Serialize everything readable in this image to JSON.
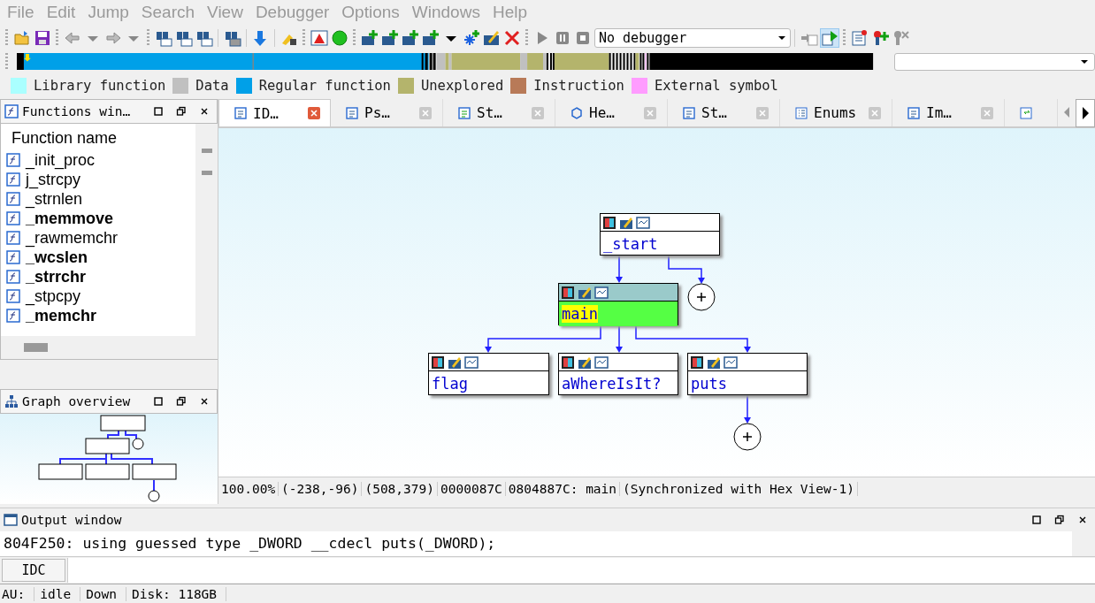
{
  "menu": [
    "File",
    "Edit",
    "Jump",
    "Search",
    "View",
    "Debugger",
    "Options",
    "Windows",
    "Help"
  ],
  "toolbar": {
    "debugger": "No debugger"
  },
  "legend": [
    {
      "label": "Library function",
      "color": "#aaffff"
    },
    {
      "label": "Data",
      "color": "#c0c0c0"
    },
    {
      "label": "Regular function",
      "color": "#00a0e8"
    },
    {
      "label": "Unexplored",
      "color": "#b4b46c"
    },
    {
      "label": "Instruction",
      "color": "#b87a58"
    },
    {
      "label": "External symbol",
      "color": "#ff9cff"
    }
  ],
  "functions_window": {
    "title": "Functions win…",
    "column": "Function name",
    "items": [
      {
        "name": "_init_proc",
        "bold": false
      },
      {
        "name": "j_strcpy",
        "bold": false
      },
      {
        "name": "_strnlen",
        "bold": false
      },
      {
        "name": "_memmove",
        "bold": true
      },
      {
        "name": "_rawmemchr",
        "bold": false
      },
      {
        "name": "_wcslen",
        "bold": true
      },
      {
        "name": "_strrchr",
        "bold": true
      },
      {
        "name": "_stpcpy",
        "bold": false
      },
      {
        "name": "_memchr",
        "bold": true
      }
    ]
  },
  "graph_overview": {
    "title": "Graph overview"
  },
  "tabs": [
    {
      "label": "ID…",
      "selected": true
    },
    {
      "label": "Ps…",
      "selected": false
    },
    {
      "label": "St…",
      "selected": false
    },
    {
      "label": "He…",
      "selected": false
    },
    {
      "label": "St…",
      "selected": false
    },
    {
      "label": "Enums",
      "selected": false
    },
    {
      "label": "Im…",
      "selected": false
    }
  ],
  "graph": {
    "nodes": [
      {
        "label": "_start",
        "selected": false
      },
      {
        "label": "main",
        "selected": true
      },
      {
        "label": "flag",
        "selected": false
      },
      {
        "label": "aWhereIsIt?",
        "selected": false
      },
      {
        "label": "puts",
        "selected": false
      }
    ]
  },
  "graph_status": [
    "100.00%",
    "(-238,-96)",
    "(508,379)",
    "0000087C",
    "0804887C: main",
    "(Synchronized with Hex View-1)"
  ],
  "output_window": {
    "title": "Output window",
    "lines": [
      "804F250: using guessed type _DWORD __cdecl puts(_DWORD);"
    ]
  },
  "command": {
    "language": "IDC"
  },
  "status_bar": [
    "AU:",
    "idle",
    "Down",
    "Disk: 118GB"
  ]
}
